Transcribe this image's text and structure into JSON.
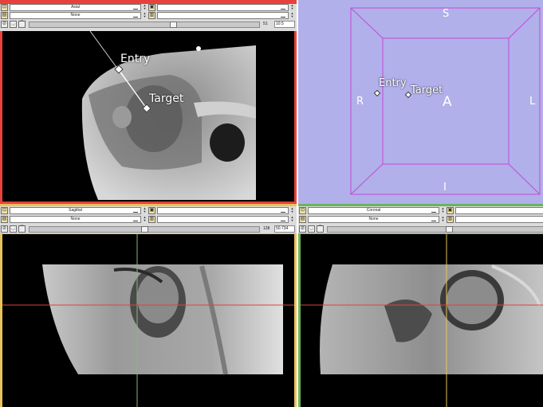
{
  "colors": {
    "red": "#e8413b",
    "yellow": "#e8c35c",
    "green": "#6cb35c",
    "threed_bg": "#b1b0ea",
    "box_line": "#c24ad8"
  },
  "red_view": {
    "orientation": "Axial",
    "label_layer": "None",
    "slice_number": "51",
    "slice_offset": "10.5",
    "fiducials": [
      {
        "label": "Entry"
      },
      {
        "label": "Target"
      }
    ]
  },
  "threed_view": {
    "orient_top": "S",
    "orient_bottom": "I",
    "orient_left": "R",
    "orient_right": "L",
    "orient_center": "A",
    "fiducials": [
      {
        "label": "Entry"
      },
      {
        "label": "Target"
      }
    ]
  },
  "yellow_view": {
    "orientation": "Sagittal",
    "label_layer": "None",
    "slice_number": "128",
    "slice_offset": "50.734"
  },
  "green_view": {
    "orientation": "Coronal",
    "label_layer": "None"
  }
}
